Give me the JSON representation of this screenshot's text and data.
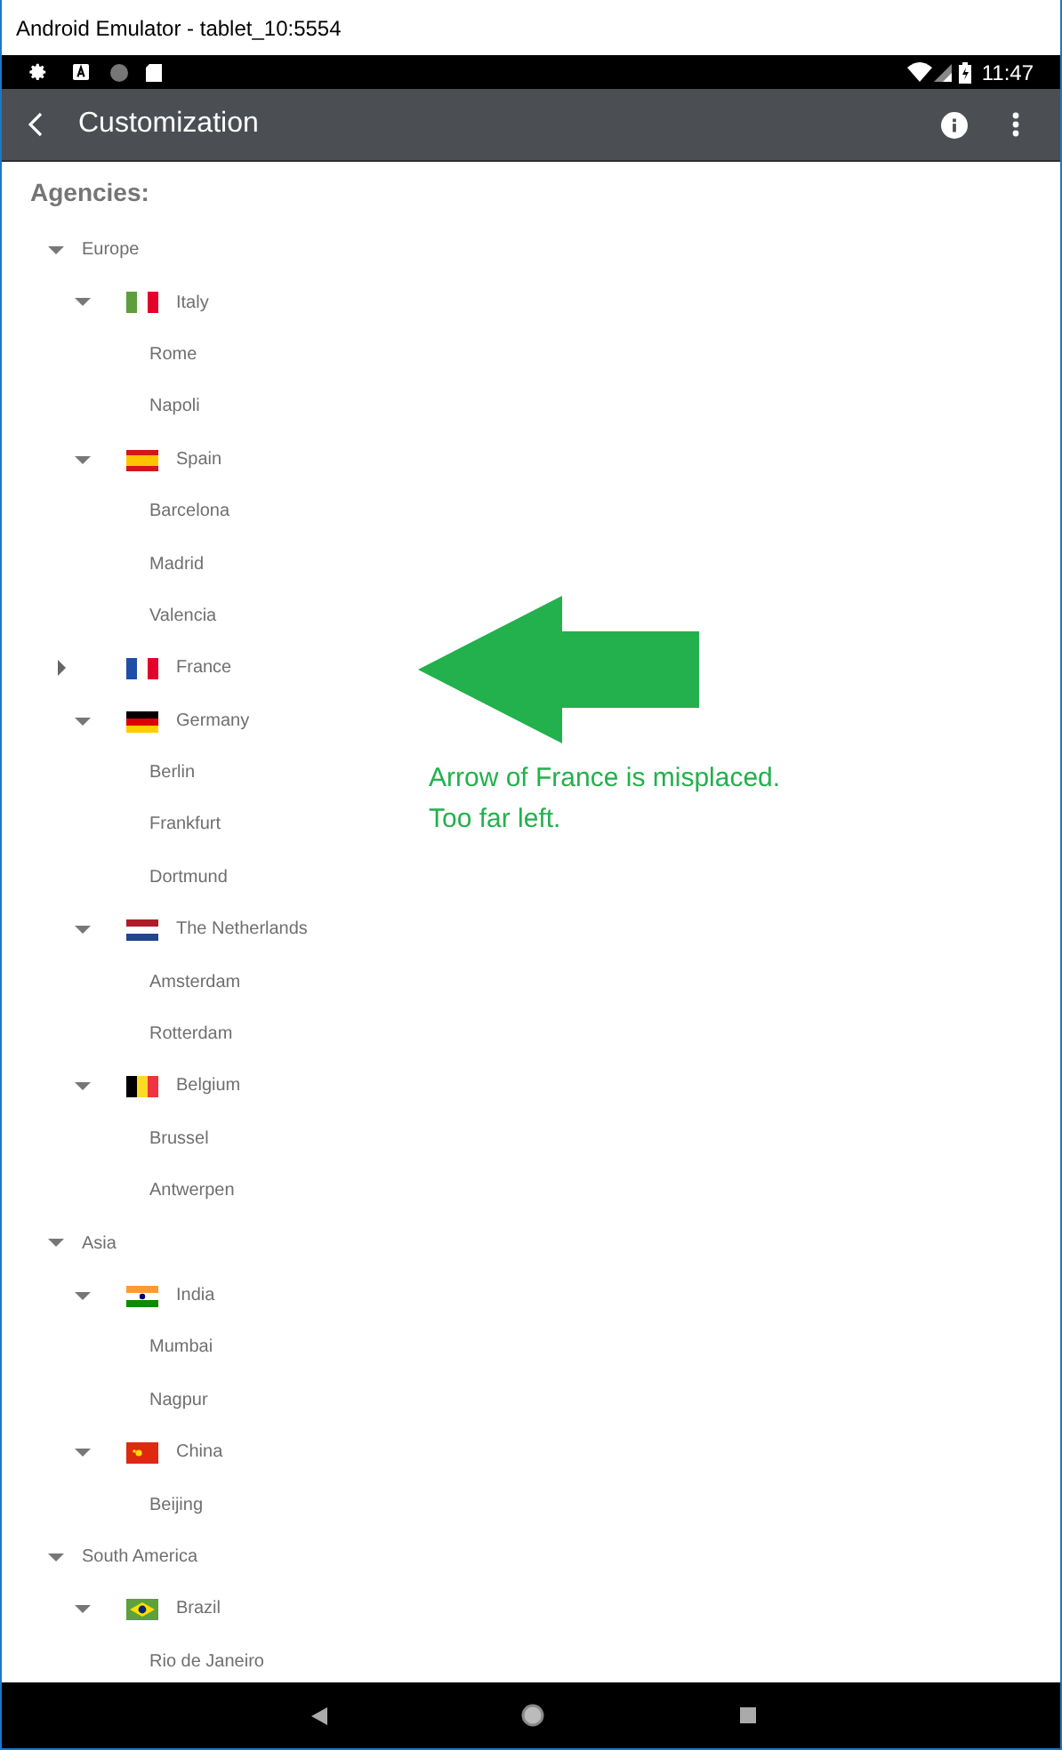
{
  "window": {
    "title": "Android Emulator - tablet_10:5554"
  },
  "status_bar": {
    "time": "11:47"
  },
  "app_bar": {
    "title": "Customization"
  },
  "section_title": "Agencies:",
  "tree": [
    {
      "label": "Europe",
      "expanded": true,
      "children": [
        {
          "label": "Italy",
          "expanded": true,
          "children": [
            {
              "label": "Rome"
            },
            {
              "label": "Napoli"
            }
          ]
        },
        {
          "label": "Spain",
          "expanded": true,
          "children": [
            {
              "label": "Barcelona"
            },
            {
              "label": "Madrid"
            },
            {
              "label": "Valencia"
            }
          ]
        },
        {
          "label": "France",
          "expanded": false
        },
        {
          "label": "Germany",
          "expanded": true,
          "children": [
            {
              "label": "Berlin"
            },
            {
              "label": "Frankfurt"
            },
            {
              "label": "Dortmund"
            }
          ]
        },
        {
          "label": "The Netherlands",
          "expanded": true,
          "children": [
            {
              "label": "Amsterdam"
            },
            {
              "label": "Rotterdam"
            }
          ]
        },
        {
          "label": "Belgium",
          "expanded": true,
          "children": [
            {
              "label": "Brussel"
            },
            {
              "label": "Antwerpen"
            }
          ]
        }
      ]
    },
    {
      "label": "Asia",
      "expanded": true,
      "children": [
        {
          "label": "India",
          "expanded": true,
          "children": [
            {
              "label": "Mumbai"
            },
            {
              "label": "Nagpur"
            }
          ]
        },
        {
          "label": "China",
          "expanded": true,
          "children": [
            {
              "label": "Beijing"
            }
          ]
        }
      ]
    },
    {
      "label": "South America",
      "expanded": true,
      "children": [
        {
          "label": "Brazil",
          "expanded": true,
          "children": [
            {
              "label": "Rio de Janeiro"
            }
          ]
        }
      ]
    }
  ],
  "annotation": {
    "lines": [
      "Arrow of France is misplaced.",
      "Too far left."
    ]
  }
}
